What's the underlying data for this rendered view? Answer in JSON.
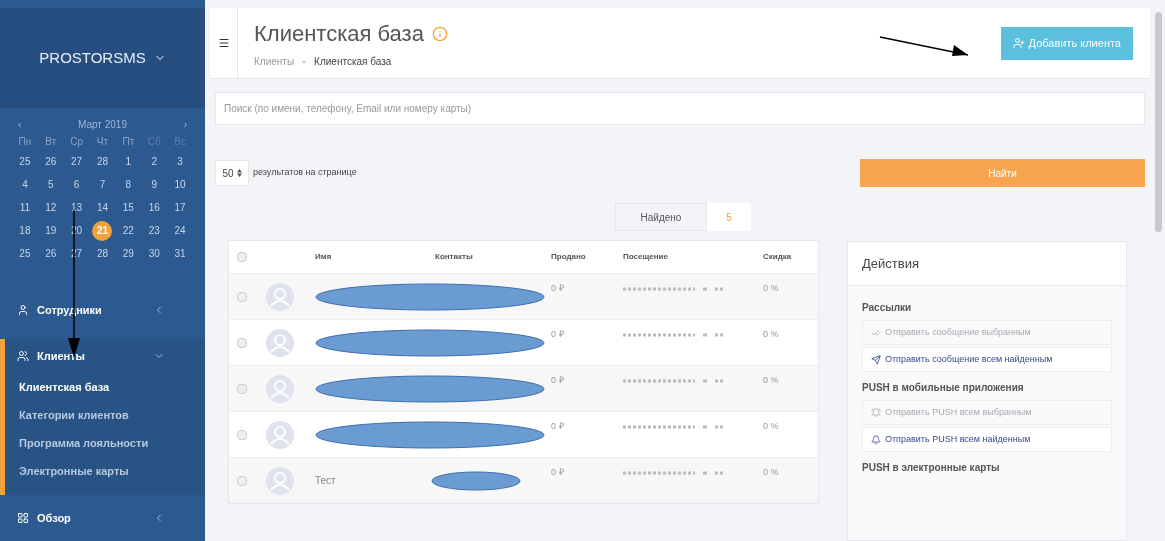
{
  "sidebar": {
    "brand": "PROSTORSMS",
    "calendar": {
      "prev": "‹",
      "month": "Март 2019",
      "next": "›",
      "weekdays": [
        {
          "label": "Пн",
          "weekend": false
        },
        {
          "label": "Вт",
          "weekend": false
        },
        {
          "label": "Ср",
          "weekend": false
        },
        {
          "label": "Чт",
          "weekend": false
        },
        {
          "label": "Пт",
          "weekend": false
        },
        {
          "label": "Сб",
          "weekend": true
        },
        {
          "label": "Вс",
          "weekend": true
        }
      ],
      "weeks": [
        [
          {
            "day": "25",
            "selected": false
          },
          {
            "day": "26",
            "selected": false
          },
          {
            "day": "27",
            "selected": false
          },
          {
            "day": "28",
            "selected": false
          },
          {
            "day": "1",
            "selected": false
          },
          {
            "day": "2",
            "selected": false
          },
          {
            "day": "3",
            "selected": false
          }
        ],
        [
          {
            "day": "4",
            "selected": false
          },
          {
            "day": "5",
            "selected": false
          },
          {
            "day": "6",
            "selected": false
          },
          {
            "day": "7",
            "selected": false
          },
          {
            "day": "8",
            "selected": false
          },
          {
            "day": "9",
            "selected": false
          },
          {
            "day": "10",
            "selected": false
          }
        ],
        [
          {
            "day": "11",
            "selected": false
          },
          {
            "day": "12",
            "selected": false
          },
          {
            "day": "13",
            "selected": false
          },
          {
            "day": "14",
            "selected": false
          },
          {
            "day": "15",
            "selected": false
          },
          {
            "day": "16",
            "selected": false
          },
          {
            "day": "17",
            "selected": false
          }
        ],
        [
          {
            "day": "18",
            "selected": false
          },
          {
            "day": "19",
            "selected": false
          },
          {
            "day": "20",
            "selected": false
          },
          {
            "day": "21",
            "selected": true
          },
          {
            "day": "22",
            "selected": false
          },
          {
            "day": "23",
            "selected": false
          },
          {
            "day": "24",
            "selected": false
          }
        ],
        [
          {
            "day": "25",
            "selected": false
          },
          {
            "day": "26",
            "selected": false
          },
          {
            "day": "27",
            "selected": false
          },
          {
            "day": "28",
            "selected": false
          },
          {
            "day": "29",
            "selected": false
          },
          {
            "day": "30",
            "selected": false
          },
          {
            "day": "31",
            "selected": false
          }
        ]
      ]
    },
    "menu": [
      {
        "label": "Сотрудники",
        "expanded": false
      },
      {
        "label": "Клиенты",
        "expanded": true,
        "children": [
          {
            "label": "Клиентская база",
            "selected": true
          },
          {
            "label": "Категории клиентов",
            "selected": false
          },
          {
            "label": "Программа лояльности",
            "selected": false
          },
          {
            "label": "Электронные карты",
            "selected": false
          }
        ]
      },
      {
        "label": "Обзор",
        "expanded": false
      }
    ]
  },
  "header": {
    "title": "Клиентская база",
    "breadcrumbs": [
      "Клиенты",
      "Клиентская база"
    ],
    "add_button": "Добавить клиента"
  },
  "search": {
    "placeholder": "Поиск (по имени, телефону, Email или номеру карты)"
  },
  "paging": {
    "per_page": "50",
    "label": "результатов на странице",
    "find_button": "Найти"
  },
  "found": {
    "label": "Найдено",
    "count": "5"
  },
  "table": {
    "select_all_checked": false,
    "columns": [
      "Имя",
      "Контакты",
      "Продано",
      "Посещение",
      "Скидка"
    ],
    "rows": [
      {
        "checked": false,
        "name": "",
        "sold": "0 ₽",
        "discount": "0 %"
      },
      {
        "checked": false,
        "name": "",
        "sold": "0 ₽",
        "discount": "0 %"
      },
      {
        "checked": false,
        "name": "",
        "sold": "0 ₽",
        "discount": "0 %"
      },
      {
        "checked": false,
        "name": "",
        "sold": "0 ₽",
        "discount": "0 %"
      },
      {
        "checked": false,
        "name": "Тест",
        "sold": "0 ₽",
        "discount": "0 %"
      }
    ]
  },
  "actions": {
    "title": "Действия",
    "groups": [
      {
        "title": "Рассылки",
        "buttons": [
          {
            "label": "Отправить сообщение выбранным",
            "disabled": true
          },
          {
            "label": "Отправить сообщение всем найденным",
            "disabled": false
          }
        ]
      },
      {
        "title": "PUSH в мобильные приложения",
        "buttons": [
          {
            "label": "Отправить PUSH всем выбранным",
            "disabled": true
          },
          {
            "label": "Отправить PUSH всем найденным",
            "disabled": false
          }
        ]
      },
      {
        "title": "PUSH в электронные карты"
      }
    ]
  }
}
